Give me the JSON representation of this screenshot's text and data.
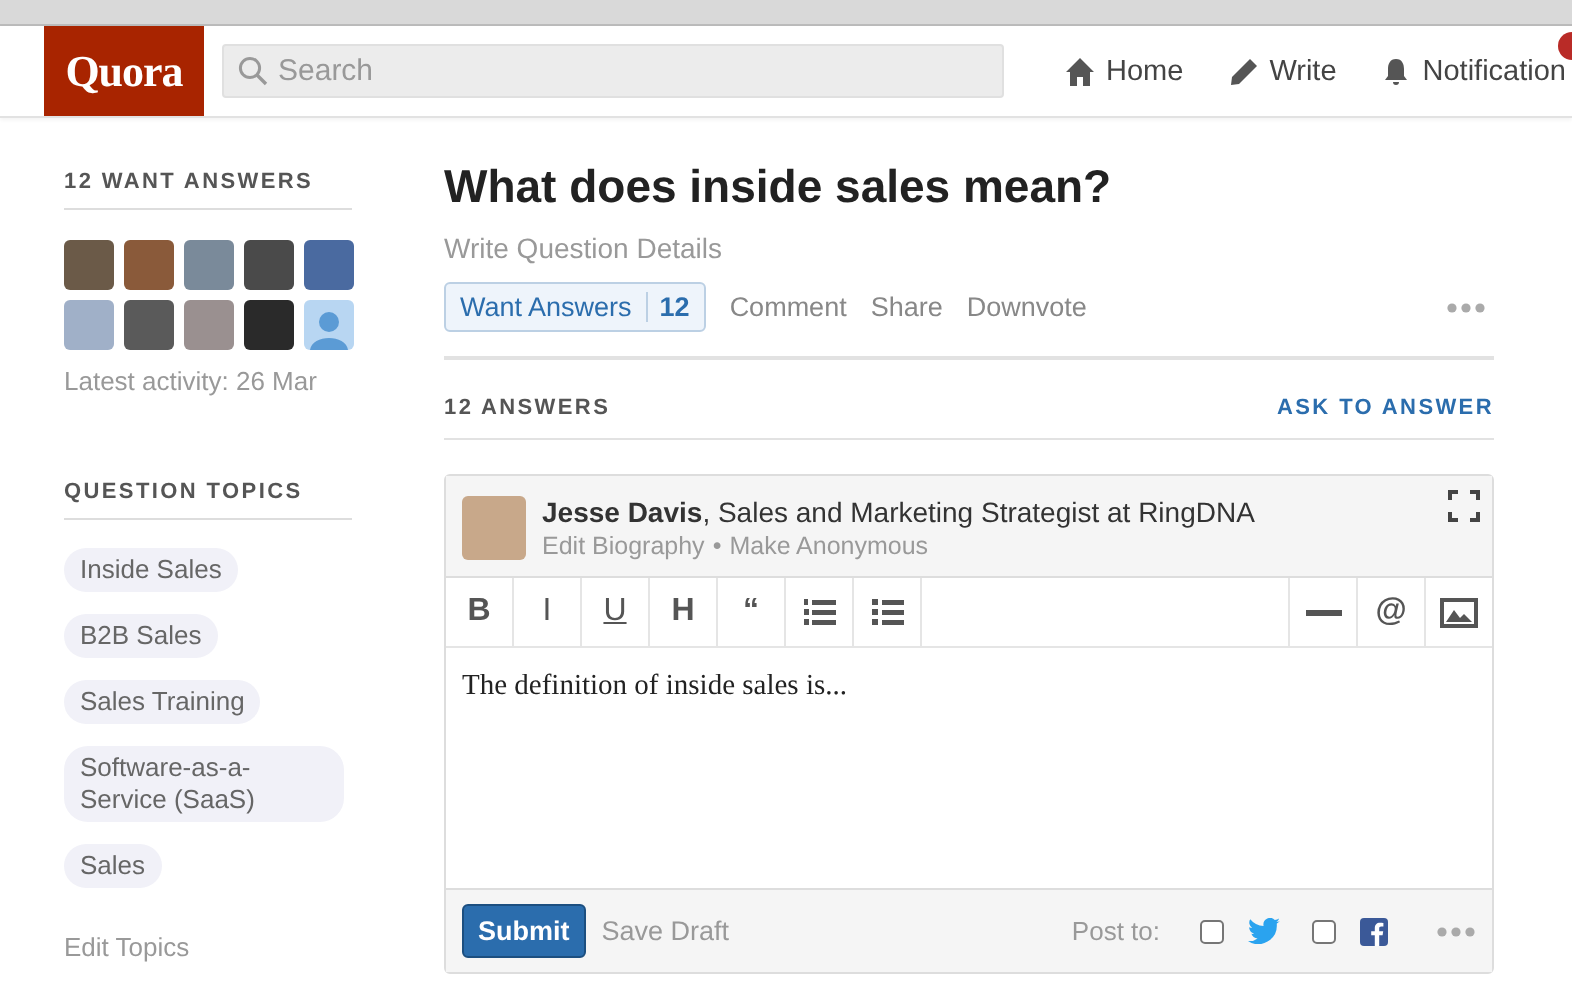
{
  "header": {
    "logo": "Quora",
    "search": {
      "placeholder": "Search"
    },
    "nav": [
      {
        "label": "Home"
      },
      {
        "label": "Write"
      },
      {
        "label": "Notification"
      }
    ]
  },
  "sidebar": {
    "want_answers": {
      "title": "12 WANT ANSWERS",
      "avatars": [
        {
          "kind": "photo"
        },
        {
          "kind": "photo"
        },
        {
          "kind": "photo"
        },
        {
          "kind": "photo"
        },
        {
          "kind": "photo"
        },
        {
          "kind": "photo"
        },
        {
          "kind": "photo"
        },
        {
          "kind": "photo"
        },
        {
          "kind": "photo"
        },
        {
          "kind": "silhouette"
        }
      ],
      "latest_activity": "Latest activity: 26 Mar"
    },
    "topics": {
      "title": "QUESTION TOPICS",
      "items": [
        "Inside Sales",
        "B2B Sales",
        "Sales Training",
        "Software-as-a-Service (SaaS)",
        "Sales"
      ],
      "edit": "Edit Topics"
    }
  },
  "question": {
    "title": "What does inside sales mean?",
    "details_link": "Write Question Details",
    "want_answers": {
      "label": "Want Answers",
      "count": "12"
    },
    "actions": [
      "Comment",
      "Share",
      "Downvote"
    ]
  },
  "answers_bar": {
    "count": "12 ANSWERS",
    "ask": "ASK TO ANSWER"
  },
  "editor": {
    "author": "Jesse Davis",
    "bio": ", Sales and Marketing Strategist at RingDNA",
    "links": [
      "Edit Biography",
      "Make Anonymous"
    ],
    "link_separator": "•",
    "toolbar": [
      {
        "kind": "bold",
        "label": "B"
      },
      {
        "kind": "italic",
        "label": "I"
      },
      {
        "kind": "underline",
        "label": "U"
      },
      {
        "kind": "heading",
        "label": "H"
      },
      {
        "kind": "quote",
        "label": "“"
      },
      {
        "kind": "numbered"
      },
      {
        "kind": "bulleted"
      },
      {
        "kind": "spacer"
      },
      {
        "kind": "rule"
      },
      {
        "kind": "mention",
        "label": "@"
      },
      {
        "kind": "image"
      }
    ],
    "content": "The definition of inside sales is...",
    "submit": "Submit",
    "save_draft": "Save Draft",
    "post_to": "Post to:",
    "share_targets": [
      {
        "kind": "twitter",
        "checked": false
      },
      {
        "kind": "facebook",
        "checked": false
      }
    ]
  }
}
